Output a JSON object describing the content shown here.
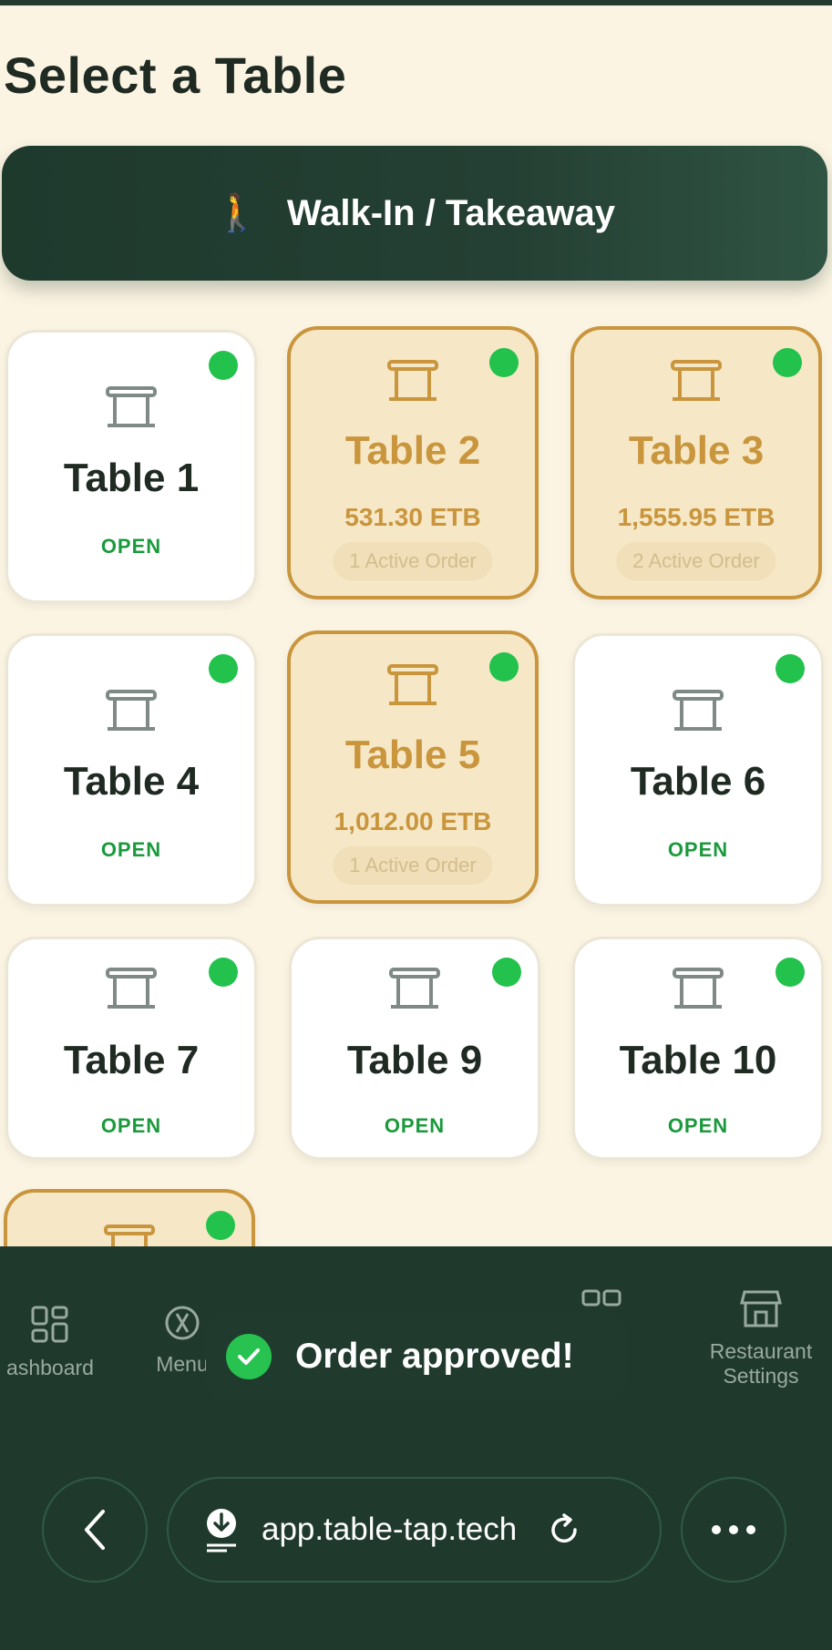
{
  "page": {
    "title": "Select a Table"
  },
  "walkin": {
    "icon": "🚶",
    "label": "Walk-In / Takeaway"
  },
  "tables": [
    {
      "name": "Table 1",
      "status": "OPEN",
      "active": false
    },
    {
      "name": "Table 2",
      "status": "",
      "active": true,
      "amount": "531.30 ETB",
      "orders": "1 Active Order"
    },
    {
      "name": "Table 3",
      "status": "",
      "active": true,
      "amount": "1,555.95 ETB",
      "orders": "2 Active Order"
    },
    {
      "name": "Table 4",
      "status": "OPEN",
      "active": false
    },
    {
      "name": "Table 5",
      "status": "",
      "active": true,
      "amount": "1,012.00 ETB",
      "orders": "1 Active Order"
    },
    {
      "name": "Table 6",
      "status": "OPEN",
      "active": false
    },
    {
      "name": "Table 7",
      "status": "OPEN",
      "active": false
    },
    {
      "name": "Table 9",
      "status": "OPEN",
      "active": false
    },
    {
      "name": "Table 10",
      "status": "OPEN",
      "active": false
    }
  ],
  "nav": {
    "dashboard_label": "ashboard",
    "menu_label": "Menu",
    "settings_label_line1": "Restaurant",
    "settings_label_line2": "Settings"
  },
  "toast": {
    "message": "Order approved!"
  },
  "browser": {
    "url": "app.table-tap.tech"
  },
  "colors": {
    "background": "#fbf4e3",
    "primary_dark": "#1f3a2c",
    "accent_gold": "#c9953d",
    "status_green": "#22c24d"
  }
}
